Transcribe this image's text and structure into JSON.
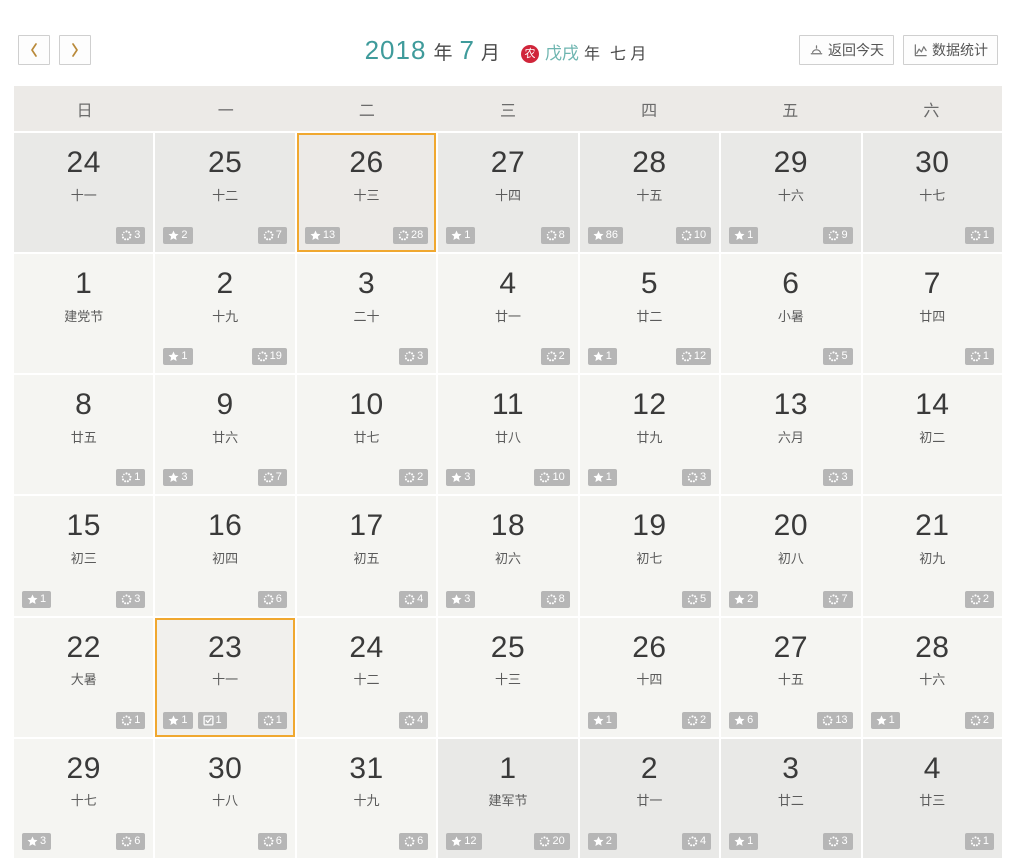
{
  "header": {
    "prev_label": "‹",
    "next_label": "›",
    "year": "2018",
    "year_unit": "年",
    "month": "7",
    "month_unit": "月",
    "lunar_mark": "农",
    "lunar_year": "戊戌",
    "lunar_year_unit": "年",
    "lunar_month": "七 月",
    "today_button": "返回今天",
    "stats_button": "数据统计",
    "accent_teal": "#3f9b9b",
    "accent_orange": "#f0a830",
    "accent_red": "#d0253a"
  },
  "weekdays": [
    "日",
    "一",
    "二",
    "三",
    "四",
    "五",
    "六"
  ],
  "days": [
    {
      "num": "24",
      "lunar": "十一",
      "out": true,
      "selected": false,
      "star": "",
      "check": "",
      "dots": "3"
    },
    {
      "num": "25",
      "lunar": "十二",
      "out": true,
      "selected": false,
      "star": "2",
      "check": "",
      "dots": "7"
    },
    {
      "num": "26",
      "lunar": "十三",
      "out": true,
      "selected": true,
      "star": "13",
      "check": "",
      "dots": "28"
    },
    {
      "num": "27",
      "lunar": "十四",
      "out": true,
      "selected": false,
      "star": "1",
      "check": "",
      "dots": "8"
    },
    {
      "num": "28",
      "lunar": "十五",
      "out": true,
      "selected": false,
      "star": "86",
      "check": "",
      "dots": "10"
    },
    {
      "num": "29",
      "lunar": "十六",
      "out": true,
      "selected": false,
      "star": "1",
      "check": "",
      "dots": "9"
    },
    {
      "num": "30",
      "lunar": "十七",
      "out": true,
      "selected": false,
      "star": "",
      "check": "",
      "dots": "1"
    },
    {
      "num": "1",
      "lunar": "建党节",
      "out": false,
      "selected": false,
      "star": "",
      "check": "",
      "dots": ""
    },
    {
      "num": "2",
      "lunar": "十九",
      "out": false,
      "selected": false,
      "star": "1",
      "check": "",
      "dots": "19"
    },
    {
      "num": "3",
      "lunar": "二十",
      "out": false,
      "selected": false,
      "star": "",
      "check": "",
      "dots": "3"
    },
    {
      "num": "4",
      "lunar": "廿一",
      "out": false,
      "selected": false,
      "star": "",
      "check": "",
      "dots": "2"
    },
    {
      "num": "5",
      "lunar": "廿二",
      "out": false,
      "selected": false,
      "star": "1",
      "check": "",
      "dots": "12"
    },
    {
      "num": "6",
      "lunar": "小暑",
      "out": false,
      "selected": false,
      "star": "",
      "check": "",
      "dots": "5"
    },
    {
      "num": "7",
      "lunar": "廿四",
      "out": false,
      "selected": false,
      "star": "",
      "check": "",
      "dots": "1"
    },
    {
      "num": "8",
      "lunar": "廿五",
      "out": false,
      "selected": false,
      "star": "",
      "check": "",
      "dots": "1"
    },
    {
      "num": "9",
      "lunar": "廿六",
      "out": false,
      "selected": false,
      "star": "3",
      "check": "",
      "dots": "7"
    },
    {
      "num": "10",
      "lunar": "廿七",
      "out": false,
      "selected": false,
      "star": "",
      "check": "",
      "dots": "2"
    },
    {
      "num": "11",
      "lunar": "廿八",
      "out": false,
      "selected": false,
      "star": "3",
      "check": "",
      "dots": "10"
    },
    {
      "num": "12",
      "lunar": "廿九",
      "out": false,
      "selected": false,
      "star": "1",
      "check": "",
      "dots": "3"
    },
    {
      "num": "13",
      "lunar": "六月",
      "out": false,
      "selected": false,
      "star": "",
      "check": "",
      "dots": "3"
    },
    {
      "num": "14",
      "lunar": "初二",
      "out": false,
      "selected": false,
      "star": "",
      "check": "",
      "dots": ""
    },
    {
      "num": "15",
      "lunar": "初三",
      "out": false,
      "selected": false,
      "star": "1",
      "check": "",
      "dots": "3"
    },
    {
      "num": "16",
      "lunar": "初四",
      "out": false,
      "selected": false,
      "star": "",
      "check": "",
      "dots": "6"
    },
    {
      "num": "17",
      "lunar": "初五",
      "out": false,
      "selected": false,
      "star": "",
      "check": "",
      "dots": "4"
    },
    {
      "num": "18",
      "lunar": "初六",
      "out": false,
      "selected": false,
      "star": "3",
      "check": "",
      "dots": "8"
    },
    {
      "num": "19",
      "lunar": "初七",
      "out": false,
      "selected": false,
      "star": "",
      "check": "",
      "dots": "5"
    },
    {
      "num": "20",
      "lunar": "初八",
      "out": false,
      "selected": false,
      "star": "2",
      "check": "",
      "dots": "7"
    },
    {
      "num": "21",
      "lunar": "初九",
      "out": false,
      "selected": false,
      "star": "",
      "check": "",
      "dots": "2"
    },
    {
      "num": "22",
      "lunar": "大暑",
      "out": false,
      "selected": false,
      "star": "",
      "check": "",
      "dots": "1"
    },
    {
      "num": "23",
      "lunar": "十一",
      "out": false,
      "selected": true,
      "star": "1",
      "check": "1",
      "dots": "1"
    },
    {
      "num": "24",
      "lunar": "十二",
      "out": false,
      "selected": false,
      "star": "",
      "check": "",
      "dots": "4"
    },
    {
      "num": "25",
      "lunar": "十三",
      "out": false,
      "selected": false,
      "star": "",
      "check": "",
      "dots": ""
    },
    {
      "num": "26",
      "lunar": "十四",
      "out": false,
      "selected": false,
      "star": "1",
      "check": "",
      "dots": "2"
    },
    {
      "num": "27",
      "lunar": "十五",
      "out": false,
      "selected": false,
      "star": "6",
      "check": "",
      "dots": "13"
    },
    {
      "num": "28",
      "lunar": "十六",
      "out": false,
      "selected": false,
      "star": "1",
      "check": "",
      "dots": "2"
    },
    {
      "num": "29",
      "lunar": "十七",
      "out": false,
      "selected": false,
      "star": "3",
      "check": "",
      "dots": "6"
    },
    {
      "num": "30",
      "lunar": "十八",
      "out": false,
      "selected": false,
      "star": "",
      "check": "",
      "dots": "6"
    },
    {
      "num": "31",
      "lunar": "十九",
      "out": false,
      "selected": false,
      "star": "",
      "check": "",
      "dots": "6"
    },
    {
      "num": "1",
      "lunar": "建军节",
      "out": true,
      "selected": false,
      "star": "12",
      "check": "",
      "dots": "20"
    },
    {
      "num": "2",
      "lunar": "廿一",
      "out": true,
      "selected": false,
      "star": "2",
      "check": "",
      "dots": "4"
    },
    {
      "num": "3",
      "lunar": "廿二",
      "out": true,
      "selected": false,
      "star": "1",
      "check": "",
      "dots": "3"
    },
    {
      "num": "4",
      "lunar": "廿三",
      "out": true,
      "selected": false,
      "star": "",
      "check": "",
      "dots": "1"
    }
  ]
}
